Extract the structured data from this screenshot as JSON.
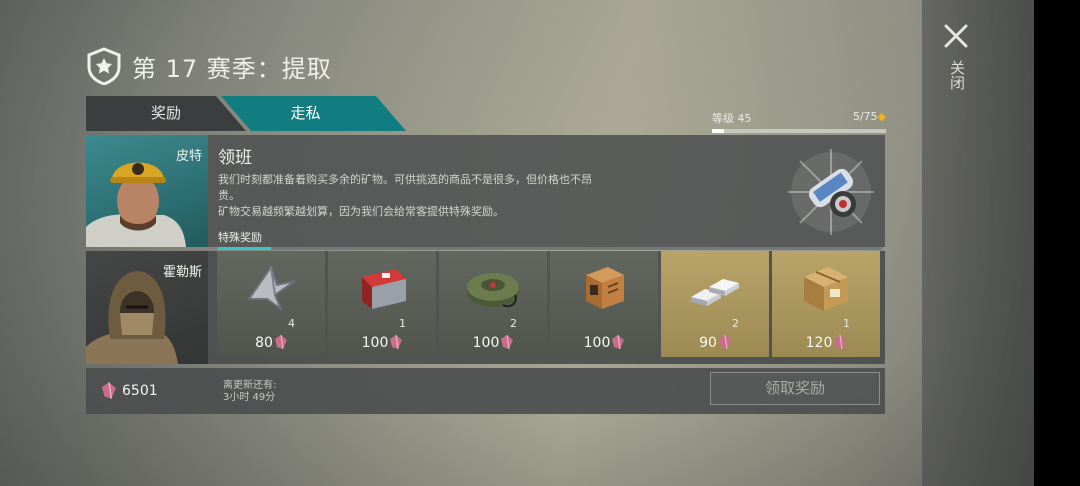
{
  "header": {
    "title": "第 17 赛季：提取"
  },
  "close": {
    "label": "关闭"
  },
  "tabs": [
    {
      "label": "奖励"
    },
    {
      "label": "走私"
    }
  ],
  "level": {
    "label": "等级 45",
    "progress": "5/75",
    "progress_fraction": 0.067
  },
  "traders": [
    {
      "name": "皮特"
    },
    {
      "name": "霍勒斯"
    }
  ],
  "offer": {
    "title": "领班",
    "line1": "我们时刻都准备着购买多余的矿物。可供挑选的商品不是很多，但价格也不昂",
    "line2": "贵。",
    "line3": "矿物交易越频繁越划算，因为我们会给常客提供特殊奖励。",
    "special_label": "特殊奖励",
    "special_fraction": 0.08
  },
  "items": [
    {
      "icon": "plane-parts-icon",
      "qty": "4",
      "price": "80",
      "highlight": false
    },
    {
      "icon": "red-toolbox-icon",
      "qty": "1",
      "price": "100",
      "highlight": false
    },
    {
      "icon": "landmine-icon",
      "qty": "2",
      "price": "100",
      "highlight": false
    },
    {
      "icon": "parts-box-icon",
      "qty": "",
      "price": "100",
      "highlight": false
    },
    {
      "icon": "metal-ingots-icon",
      "qty": "2",
      "price": "90",
      "highlight": true
    },
    {
      "icon": "cardboard-box-icon",
      "qty": "1",
      "price": "120",
      "highlight": true
    }
  ],
  "footer": {
    "balance": "6501",
    "refresh_label": "离更新还有:",
    "refresh_time": "3小时 49分",
    "claim_label": "领取奖励"
  },
  "colors": {
    "accent": "#127d80",
    "crystal": "#c86e8c",
    "gold_tile": "#b9a468",
    "diamond": "#f0b21a"
  }
}
